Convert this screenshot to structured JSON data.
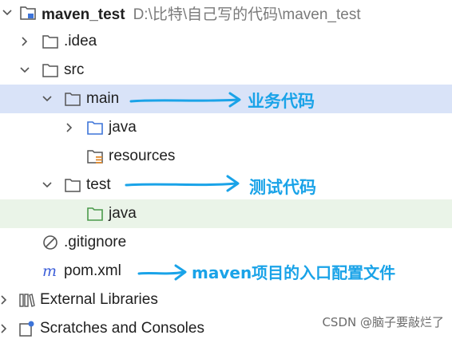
{
  "project": {
    "name": "maven_test",
    "path": "D:\\比特\\自己写的代码\\maven_test"
  },
  "tree": {
    "idea": ".idea",
    "src": "src",
    "main": "main",
    "main_java": "java",
    "resources": "resources",
    "test": "test",
    "test_java": "java",
    "gitignore": ".gitignore",
    "pom": "pom.xml",
    "external_libraries": "External Libraries",
    "scratches": "Scratches and Consoles"
  },
  "annotations": {
    "main": "业务代码",
    "test": "测试代码",
    "pom": "maven项目的入口配置文件"
  },
  "watermark": "CSDN @脑子要敲烂了",
  "colors": {
    "selection": "#d9e3f8",
    "highlight": "#eaf4e8",
    "annotation": "#1aa3e8",
    "source_folder": "#3d74d9",
    "test_folder": "#4a9a4a",
    "resource_accent": "#e08a2e",
    "maven_m": "#3d5fd9"
  }
}
